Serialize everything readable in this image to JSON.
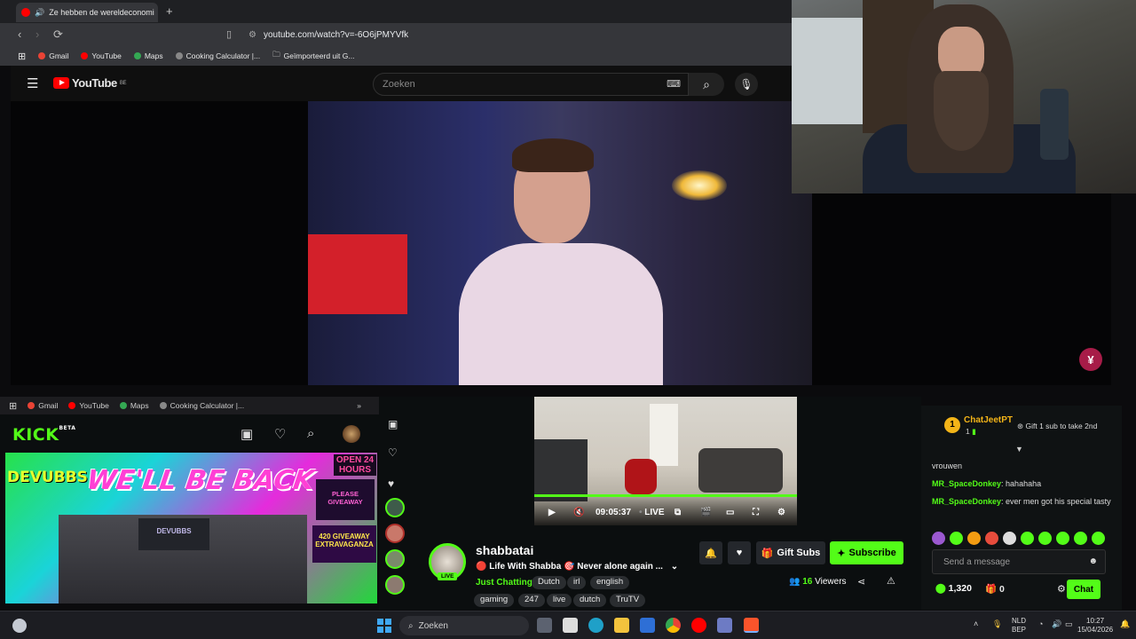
{
  "browser": {
    "tab_title": "Ze hebben de wereldeconomi",
    "url": "youtube.com/watch?v=-6O6jPMYVfk",
    "bookmarks": [
      "Gmail",
      "YouTube",
      "Maps",
      "Cooking Calculator |...",
      "Geïmporteerd uit G..."
    ]
  },
  "youtube": {
    "logo": "YouTube",
    "region": "BE",
    "search_placeholder": "Zoeken",
    "channel_badge": "¥"
  },
  "kick_browser": {
    "bookmarks": [
      "Gmail",
      "YouTube",
      "Maps",
      "Cooking Calculator |..."
    ],
    "more": "»"
  },
  "kick": {
    "logo": "KICK",
    "logo_sup": "BETA",
    "thumbnail": {
      "left_text": "DEVUBBS",
      "title": "WE'LL BE BACK",
      "open_label": "OPEN 24 HOURS",
      "giveaway": "PLEASE GIVEAWAY",
      "giveaway_420": "420 GIVEAWAY EXTRAVAGANZA",
      "monitor": "DEVUBBS"
    },
    "player": {
      "time": "09:05:37",
      "live": "LIVE"
    },
    "channel": {
      "name": "shabbatai",
      "live_badge": "LIVE",
      "title": "🔴 Life With Shabba 🎯 Never alone again ...",
      "category": "Just Chatting",
      "tags_row1": [
        "Dutch",
        "irl",
        "english"
      ],
      "tags_row2": [
        "gaming",
        "247",
        "live",
        "dutch",
        "TruTV"
      ],
      "viewers_count": "16",
      "viewers_label": "Viewers"
    },
    "buttons": {
      "gift_subs": "Gift Subs",
      "subscribe": "Subscribe"
    }
  },
  "chat": {
    "pinned_user": "ChatJeetPT",
    "pinned_count": "1",
    "coin_rank": "1",
    "gift_prompt": "Gift 1 sub to take 2nd",
    "messages": [
      {
        "user": "",
        "text": "vrouwen"
      },
      {
        "user": "MR_SpaceDonkey",
        "text": "hahahaha"
      },
      {
        "user": "MR_SpaceDonkey",
        "text": "ever men got his special tasty"
      }
    ],
    "input_placeholder": "Send a message",
    "points": "1,320",
    "gifts": "0",
    "send_label": "Chat"
  },
  "taskbar": {
    "search_placeholder": "Zoeken",
    "lang_top": "NLD",
    "lang_bottom": "BEP",
    "time": "10:27",
    "date": "15/04/2026"
  }
}
